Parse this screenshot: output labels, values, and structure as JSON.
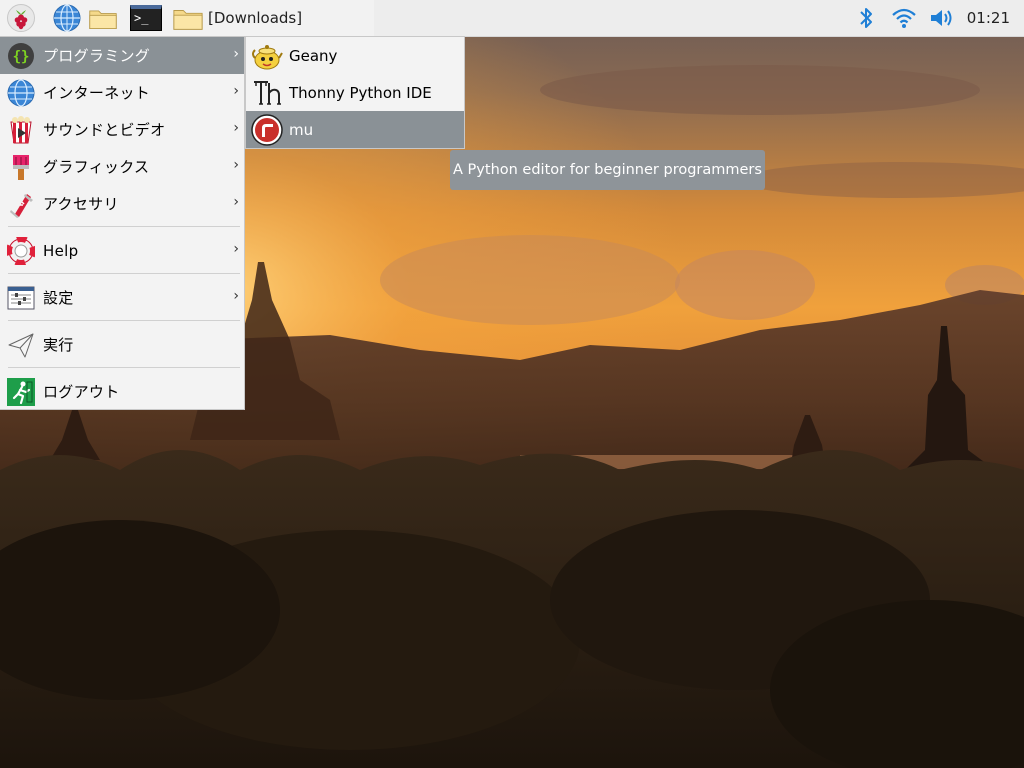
{
  "panel": {
    "launcher_icon": "raspberry-pi-icon",
    "browser_icon": "globe-icon",
    "files_icon": "folder-icon",
    "terminal_icon": "terminal-icon",
    "terminal_glyph": ">_",
    "taskbar_window_title": "[Downloads]",
    "bluetooth_icon": "bluetooth-icon",
    "wifi_icon": "wifi-icon",
    "volume_icon": "volume-icon",
    "clock": "01:21"
  },
  "main_menu": {
    "items": [
      {
        "label": "プログラミング",
        "icon": "programming-icon",
        "has_submenu": true,
        "active": true
      },
      {
        "label": "インターネット",
        "icon": "globe-icon",
        "has_submenu": true
      },
      {
        "label": "サウンドとビデオ",
        "icon": "sound-video-icon",
        "has_submenu": true
      },
      {
        "label": "グラフィックス",
        "icon": "graphics-icon",
        "has_submenu": true
      },
      {
        "label": "アクセサリ",
        "icon": "accessories-icon",
        "has_submenu": true
      },
      {
        "label": "Help",
        "icon": "help-icon",
        "has_submenu": true
      },
      {
        "label": "設定",
        "icon": "settings-icon",
        "has_submenu": true
      },
      {
        "label": "実行",
        "icon": "run-icon",
        "has_submenu": false
      },
      {
        "label": "ログアウト",
        "icon": "logout-icon",
        "has_submenu": false
      }
    ],
    "submenu_arrow": "›"
  },
  "sub_menu": {
    "items": [
      {
        "label": "Geany",
        "icon": "geany-icon"
      },
      {
        "label": "Thonny Python IDE",
        "icon": "thonny-icon"
      },
      {
        "label": "mu",
        "icon": "mu-icon",
        "active": true
      }
    ]
  },
  "tooltip": {
    "text": "A Python editor for beginner programmers"
  },
  "colors": {
    "menu_bg": "#f3f3f3",
    "menu_highlight": "#8a9196",
    "panel_bg": "#ededed",
    "accent_blue": "#1f7fd6"
  }
}
